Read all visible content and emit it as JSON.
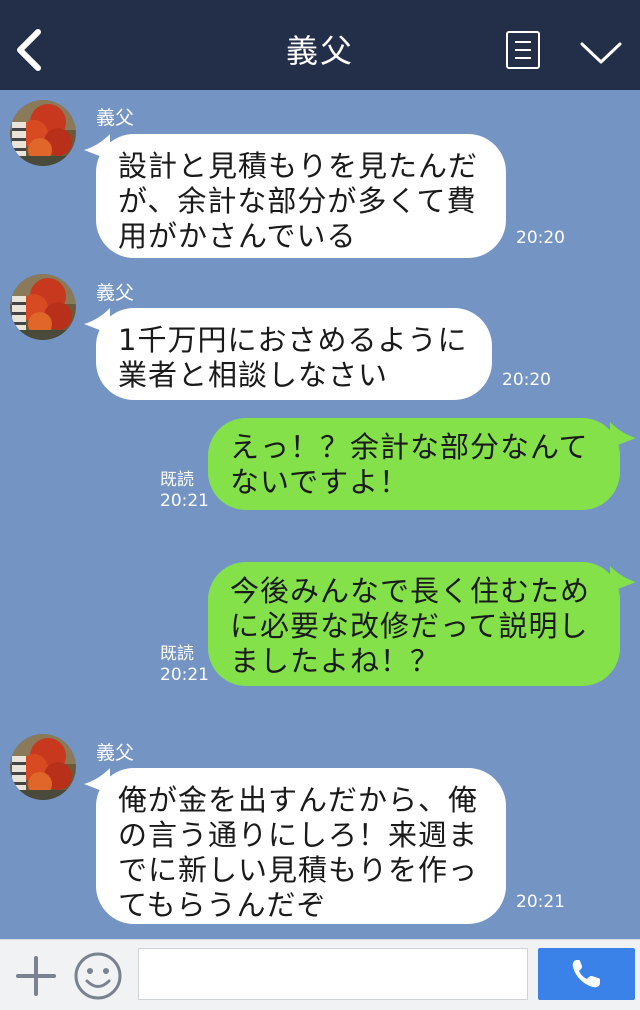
{
  "header": {
    "title": "義父",
    "icons": {
      "back": "chevron-left-icon",
      "menu": "menu-list-icon",
      "collapse": "chevron-down-icon"
    }
  },
  "colors": {
    "background": "#7494c4",
    "header": "#232e48",
    "incoming_bubble": "#ffffff",
    "outgoing_bubble": "#84e14a",
    "call_button": "#3b82e8"
  },
  "messages": [
    {
      "direction": "in",
      "sender": "義父",
      "lines": [
        "設計と見積もりを見たんだ",
        "が、余計な部分が多くて費",
        "用がかさんでいる"
      ],
      "time": "20:20"
    },
    {
      "direction": "in",
      "sender": "義父",
      "lines": [
        "1千万円におさめるように",
        "業者と相談しなさい"
      ],
      "time": "20:20"
    },
    {
      "direction": "out",
      "lines": [
        "えっ！？余計な部分なんて",
        "ないですよ！"
      ],
      "read": "既読",
      "time": "20:21"
    },
    {
      "direction": "out",
      "lines": [
        "今後みんなで長く住むため",
        "に必要な改修だって説明し",
        "ましたよね！？"
      ],
      "read": "既読",
      "time": "20:21"
    },
    {
      "direction": "in",
      "sender": "義父",
      "lines": [
        "俺が金を出すんだから、俺",
        "の言う通りにしろ！来週ま",
        "でに新しい見積もりを作っ",
        "てもらうんだぞ"
      ],
      "time": "20:21"
    }
  ],
  "input_bar": {
    "placeholder": "",
    "icons": {
      "plus": "plus-icon",
      "emoji": "smiley-icon",
      "call": "phone-icon"
    }
  }
}
